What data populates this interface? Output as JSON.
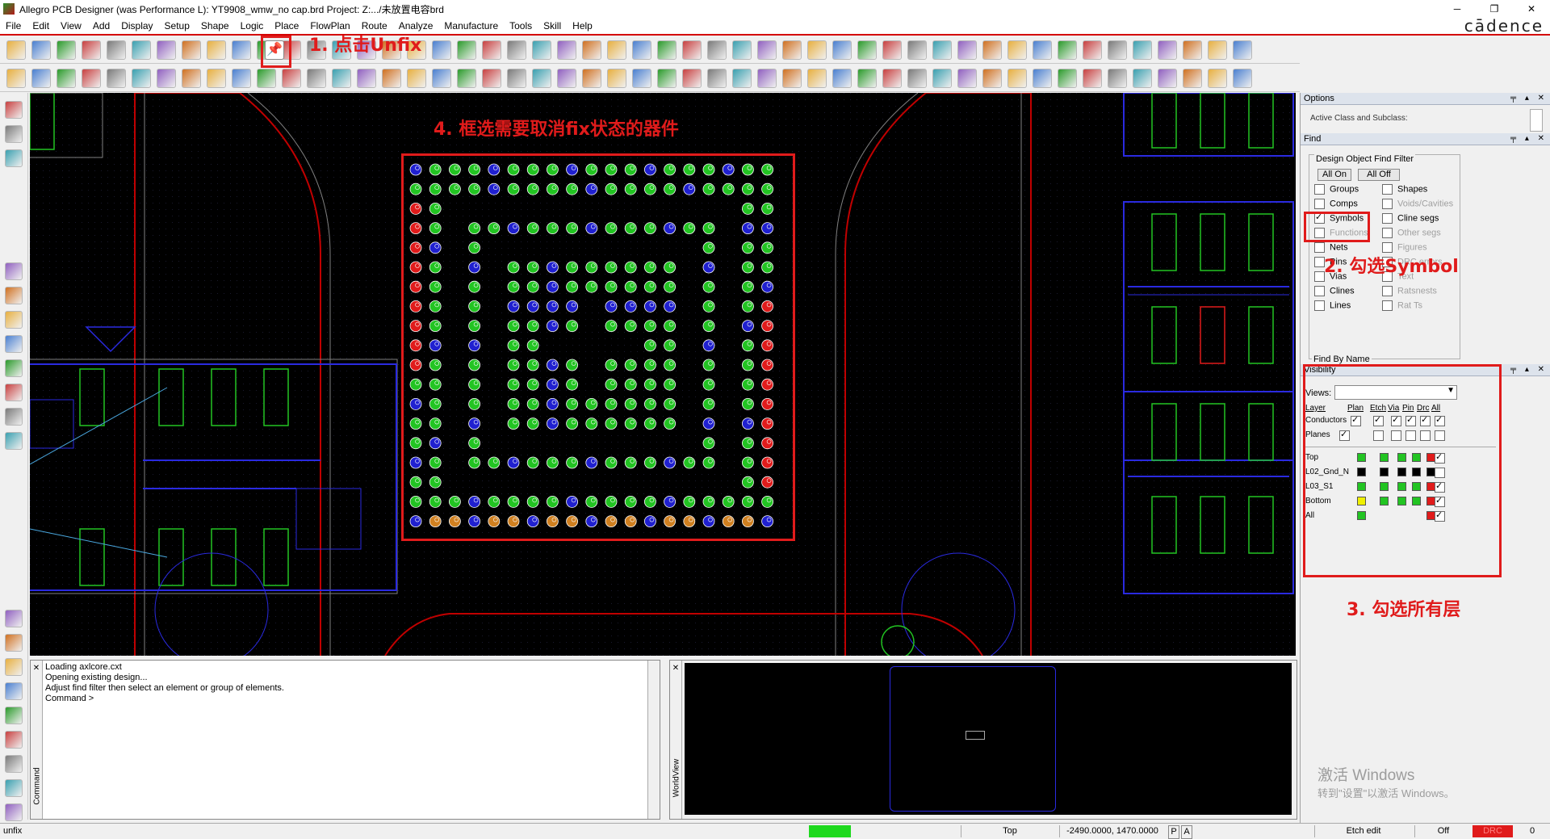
{
  "window": {
    "title": "Allegro PCB Designer (was Performance L): YT9908_wmw_no cap.brd  Project: Z:.../未放置电容brd",
    "minimize": "─",
    "restore": "❐",
    "close": "✕",
    "brand": "cādence"
  },
  "menu": [
    "File",
    "Edit",
    "View",
    "Add",
    "Display",
    "Setup",
    "Shape",
    "Logic",
    "Place",
    "FlowPlan",
    "Route",
    "Analyze",
    "Manufacture",
    "Tools",
    "Skill",
    "Help"
  ],
  "annotations": {
    "step1": "1. 点击Unfix",
    "step2": "2. 勾选Symbol",
    "step3": "3. 勾选所有层",
    "step4": "4. 框选需要取消fix状态的器件"
  },
  "options_panel": {
    "title": "Options",
    "subtitle": "Active Class and Subclass:"
  },
  "find_panel": {
    "title": "Find",
    "group_title": "Design Object Find Filter",
    "all_on": "All On",
    "all_off": "All Off",
    "left_items": [
      {
        "label": "Groups",
        "checked": false,
        "enabled": true
      },
      {
        "label": "Comps",
        "checked": false,
        "enabled": true
      },
      {
        "label": "Symbols",
        "checked": true,
        "enabled": true
      },
      {
        "label": "Functions",
        "checked": false,
        "enabled": false
      },
      {
        "label": "Nets",
        "checked": false,
        "enabled": true
      },
      {
        "label": "Pins",
        "checked": false,
        "enabled": true
      },
      {
        "label": "Vias",
        "checked": false,
        "enabled": true
      },
      {
        "label": "Clines",
        "checked": false,
        "enabled": true
      },
      {
        "label": "Lines",
        "checked": false,
        "enabled": true
      }
    ],
    "right_items": [
      {
        "label": "Shapes",
        "checked": false,
        "enabled": true
      },
      {
        "label": "Voids/Cavities",
        "checked": false,
        "enabled": false
      },
      {
        "label": "Cline segs",
        "checked": false,
        "enabled": true
      },
      {
        "label": "Other segs",
        "checked": false,
        "enabled": false
      },
      {
        "label": "Figures",
        "checked": false,
        "enabled": false
      },
      {
        "label": "DRC errors",
        "checked": false,
        "enabled": false
      },
      {
        "label": "Text",
        "checked": false,
        "enabled": false
      },
      {
        "label": "Ratsnests",
        "checked": false,
        "enabled": false
      },
      {
        "label": "Rat Ts",
        "checked": false,
        "enabled": false
      }
    ],
    "find_by_name": "Find By Name"
  },
  "visibility_panel": {
    "title": "Visibility",
    "views_label": "Views:",
    "views_value": "",
    "headers": [
      "Layer",
      "Plan",
      "Etch",
      "Via",
      "Pin",
      "Drc",
      "All"
    ],
    "rows": [
      {
        "label": "Conductors",
        "checks": [
          true,
          true,
          true,
          true,
          true,
          true
        ]
      },
      {
        "label": "Planes",
        "checks": [
          true,
          false,
          false,
          false,
          false,
          false
        ]
      }
    ],
    "layers": [
      {
        "label": "Top",
        "colors": [
          "#22c422",
          "#22c422",
          "#22c422",
          "#22c422",
          "#e01b1b"
        ],
        "all": true
      },
      {
        "label": "L02_Gnd_N",
        "colors": [
          "#000000",
          "#000000",
          "#000000",
          "#000000",
          "#000000"
        ],
        "all": false
      },
      {
        "label": "L03_S1",
        "colors": [
          "#22c422",
          "#22c422",
          "#22c422",
          "#22c422",
          "#e01b1b"
        ],
        "all": true
      },
      {
        "label": "Bottom",
        "colors": [
          "#f0f000",
          "#22c422",
          "#22c422",
          "#22c422",
          "#e01b1b"
        ],
        "all": true
      },
      {
        "label": "All",
        "colors": [
          "#22c422",
          "",
          "",
          "",
          "#e01b1b"
        ],
        "all": true
      }
    ]
  },
  "console": {
    "side_label": "Command",
    "lines": [
      "Loading axlcore.cxt",
      "Opening existing design...",
      "Adjust find filter then select an element or group of elements.",
      "Command >"
    ]
  },
  "worldview": {
    "side_label": "WorldView"
  },
  "watermark": {
    "line1": "激活 Windows",
    "line2": "转到\"设置\"以激活 Windows。"
  },
  "status": {
    "command": "unfix",
    "layer": "Top",
    "coords": "-2490.0000, 1470.0000",
    "p": "P",
    "a": "A",
    "mode": "Etch edit",
    "off": "Off",
    "drc": "DRC",
    "count": "0",
    "colors": {
      "ready": "#1ed91e",
      "drc": "#e01b1b"
    }
  }
}
